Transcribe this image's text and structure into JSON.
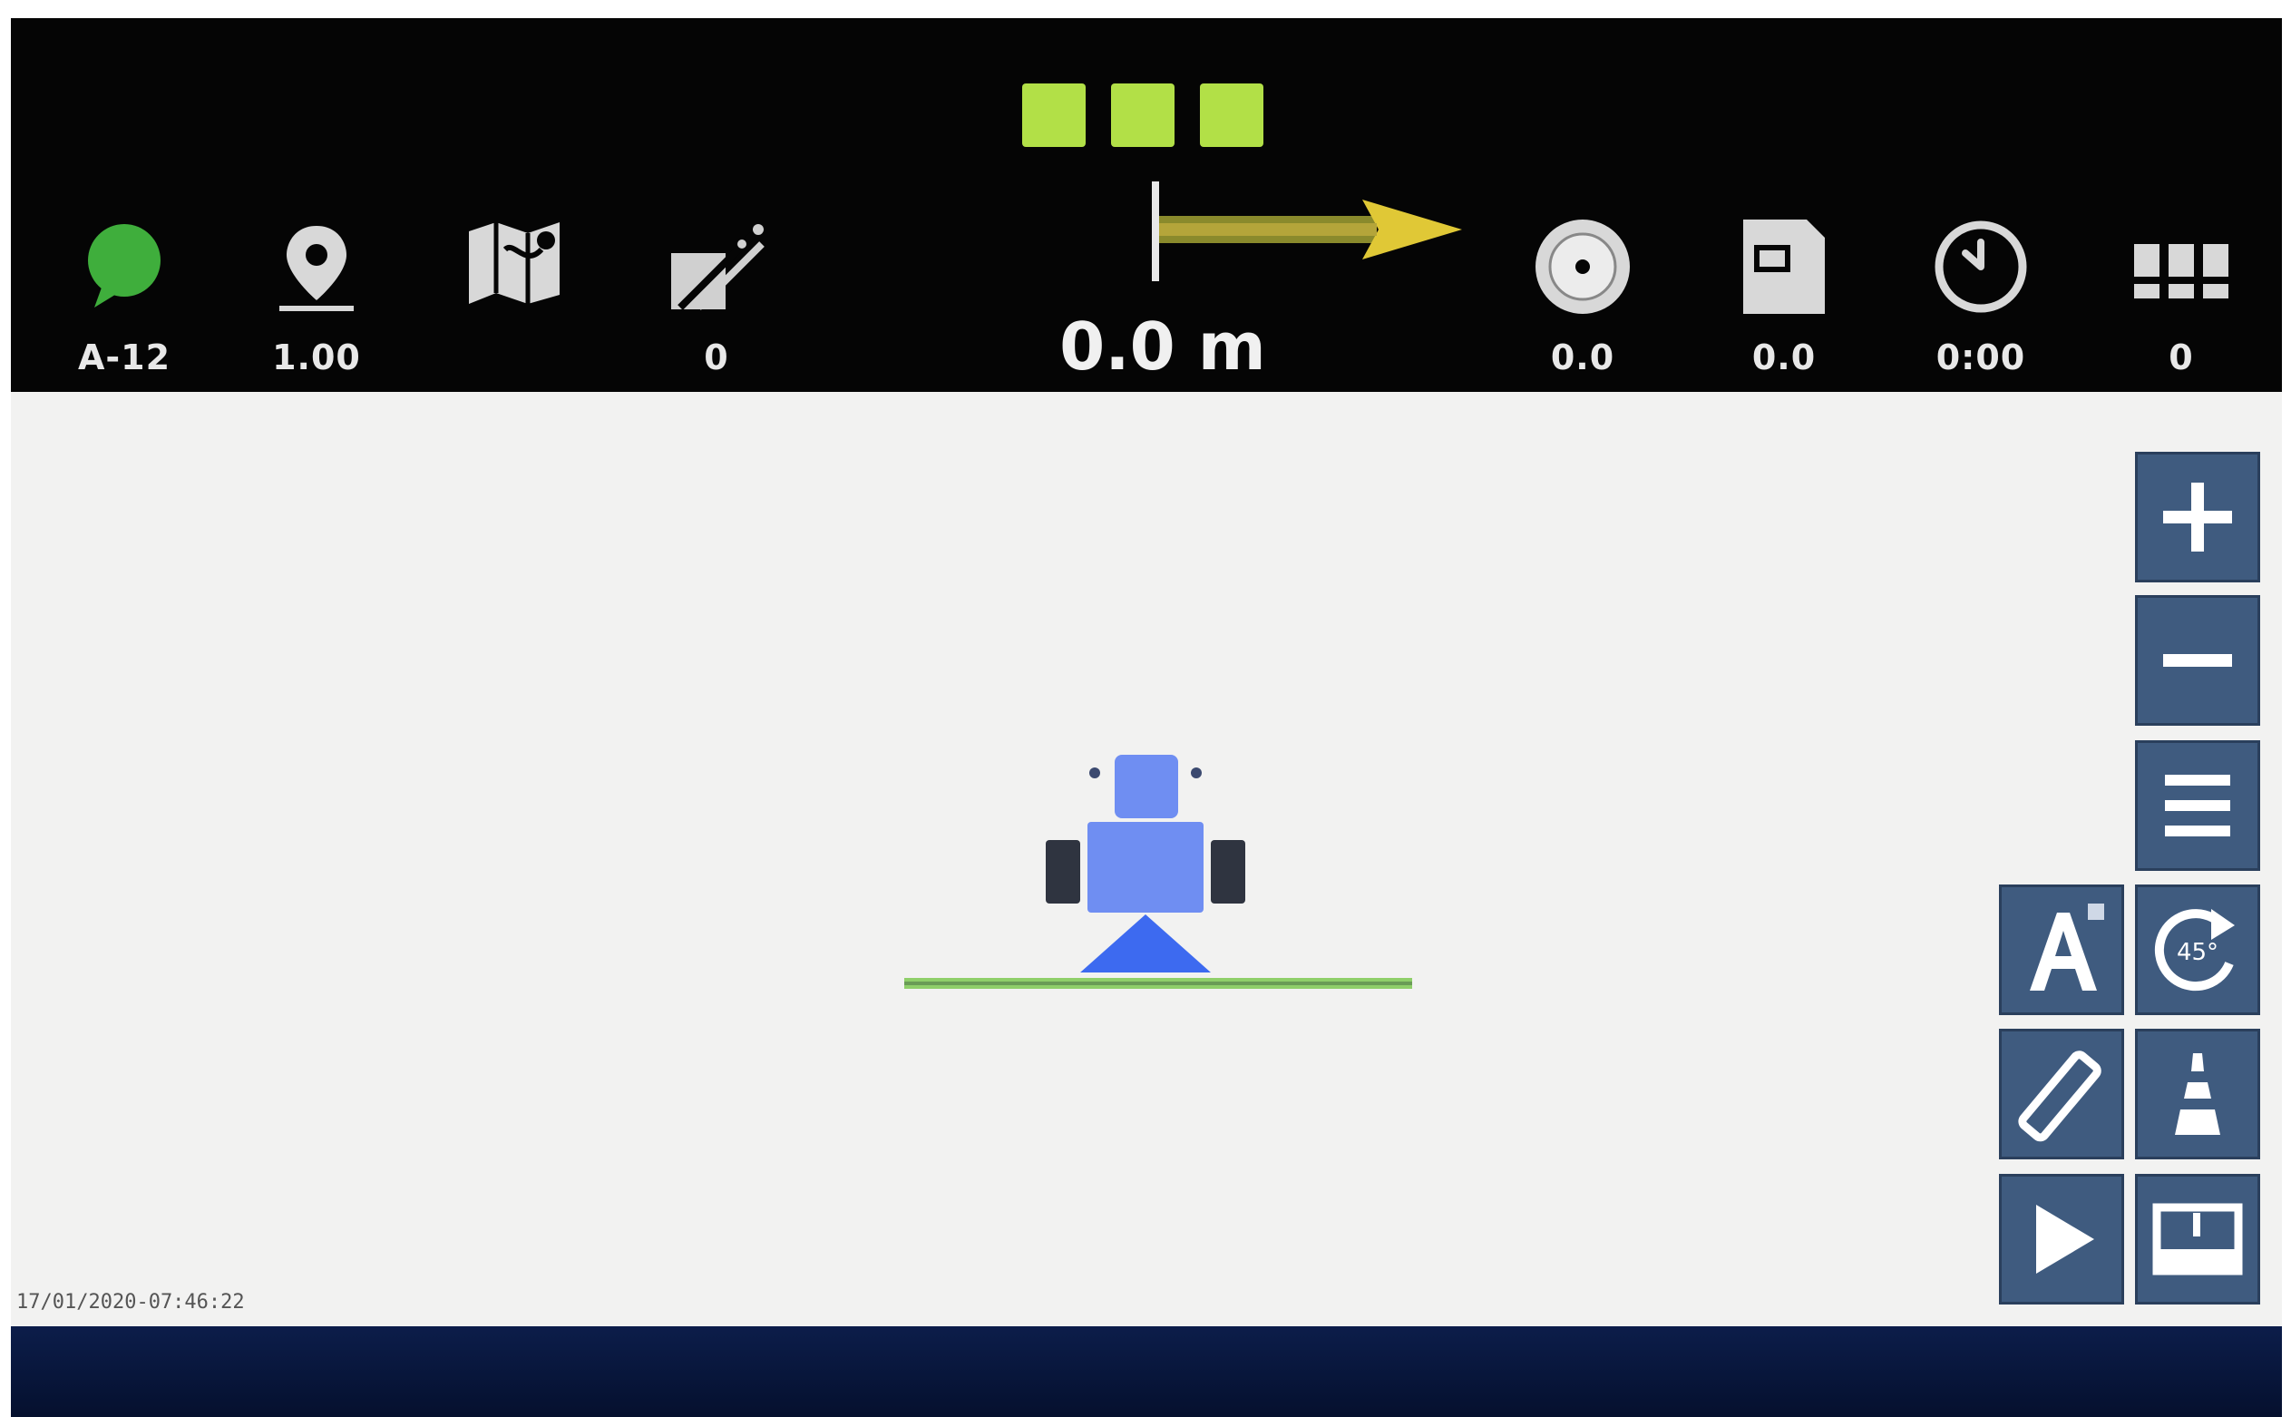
{
  "status_bar": {
    "gnss": {
      "icon": "satellite-signal-icon",
      "value": "A-12"
    },
    "position": {
      "icon": "map-pin-icon",
      "value": "1.00"
    },
    "field": {
      "icon": "field-map-icon"
    },
    "guidance_lines": {
      "icon": "guidance-line-icon",
      "value": "0"
    },
    "cross_track_distance": "0.0 m",
    "speed": {
      "icon": "speedometer-icon",
      "value": "0.0"
    },
    "area": {
      "icon": "area-document-icon",
      "value": "0.0"
    },
    "time": {
      "icon": "clock-icon",
      "value": "0:00"
    },
    "sections": {
      "icon": "sections-icon",
      "value": "0"
    }
  },
  "lightbar": {
    "active_color": "#b2e047",
    "count": 3
  },
  "colors": {
    "vehicle": "#6f8ef2",
    "implement": "#3d6af0",
    "boom": "#8fcf6a",
    "button": "#3f5b7f"
  },
  "map": {
    "timestamp": "17/01/2020-07:46:22"
  },
  "side_buttons": [
    {
      "icon": "zoom-in-icon"
    },
    {
      "icon": "zoom-out-icon"
    },
    {
      "icon": "menu-icon"
    },
    {
      "icon": "auto-steer-icon"
    },
    {
      "icon": "rotate-view-icon"
    },
    {
      "icon": "guidance-pattern-icon"
    },
    {
      "icon": "perspective-view-icon"
    },
    {
      "icon": "play-icon"
    },
    {
      "icon": "screen-layout-icon"
    }
  ]
}
